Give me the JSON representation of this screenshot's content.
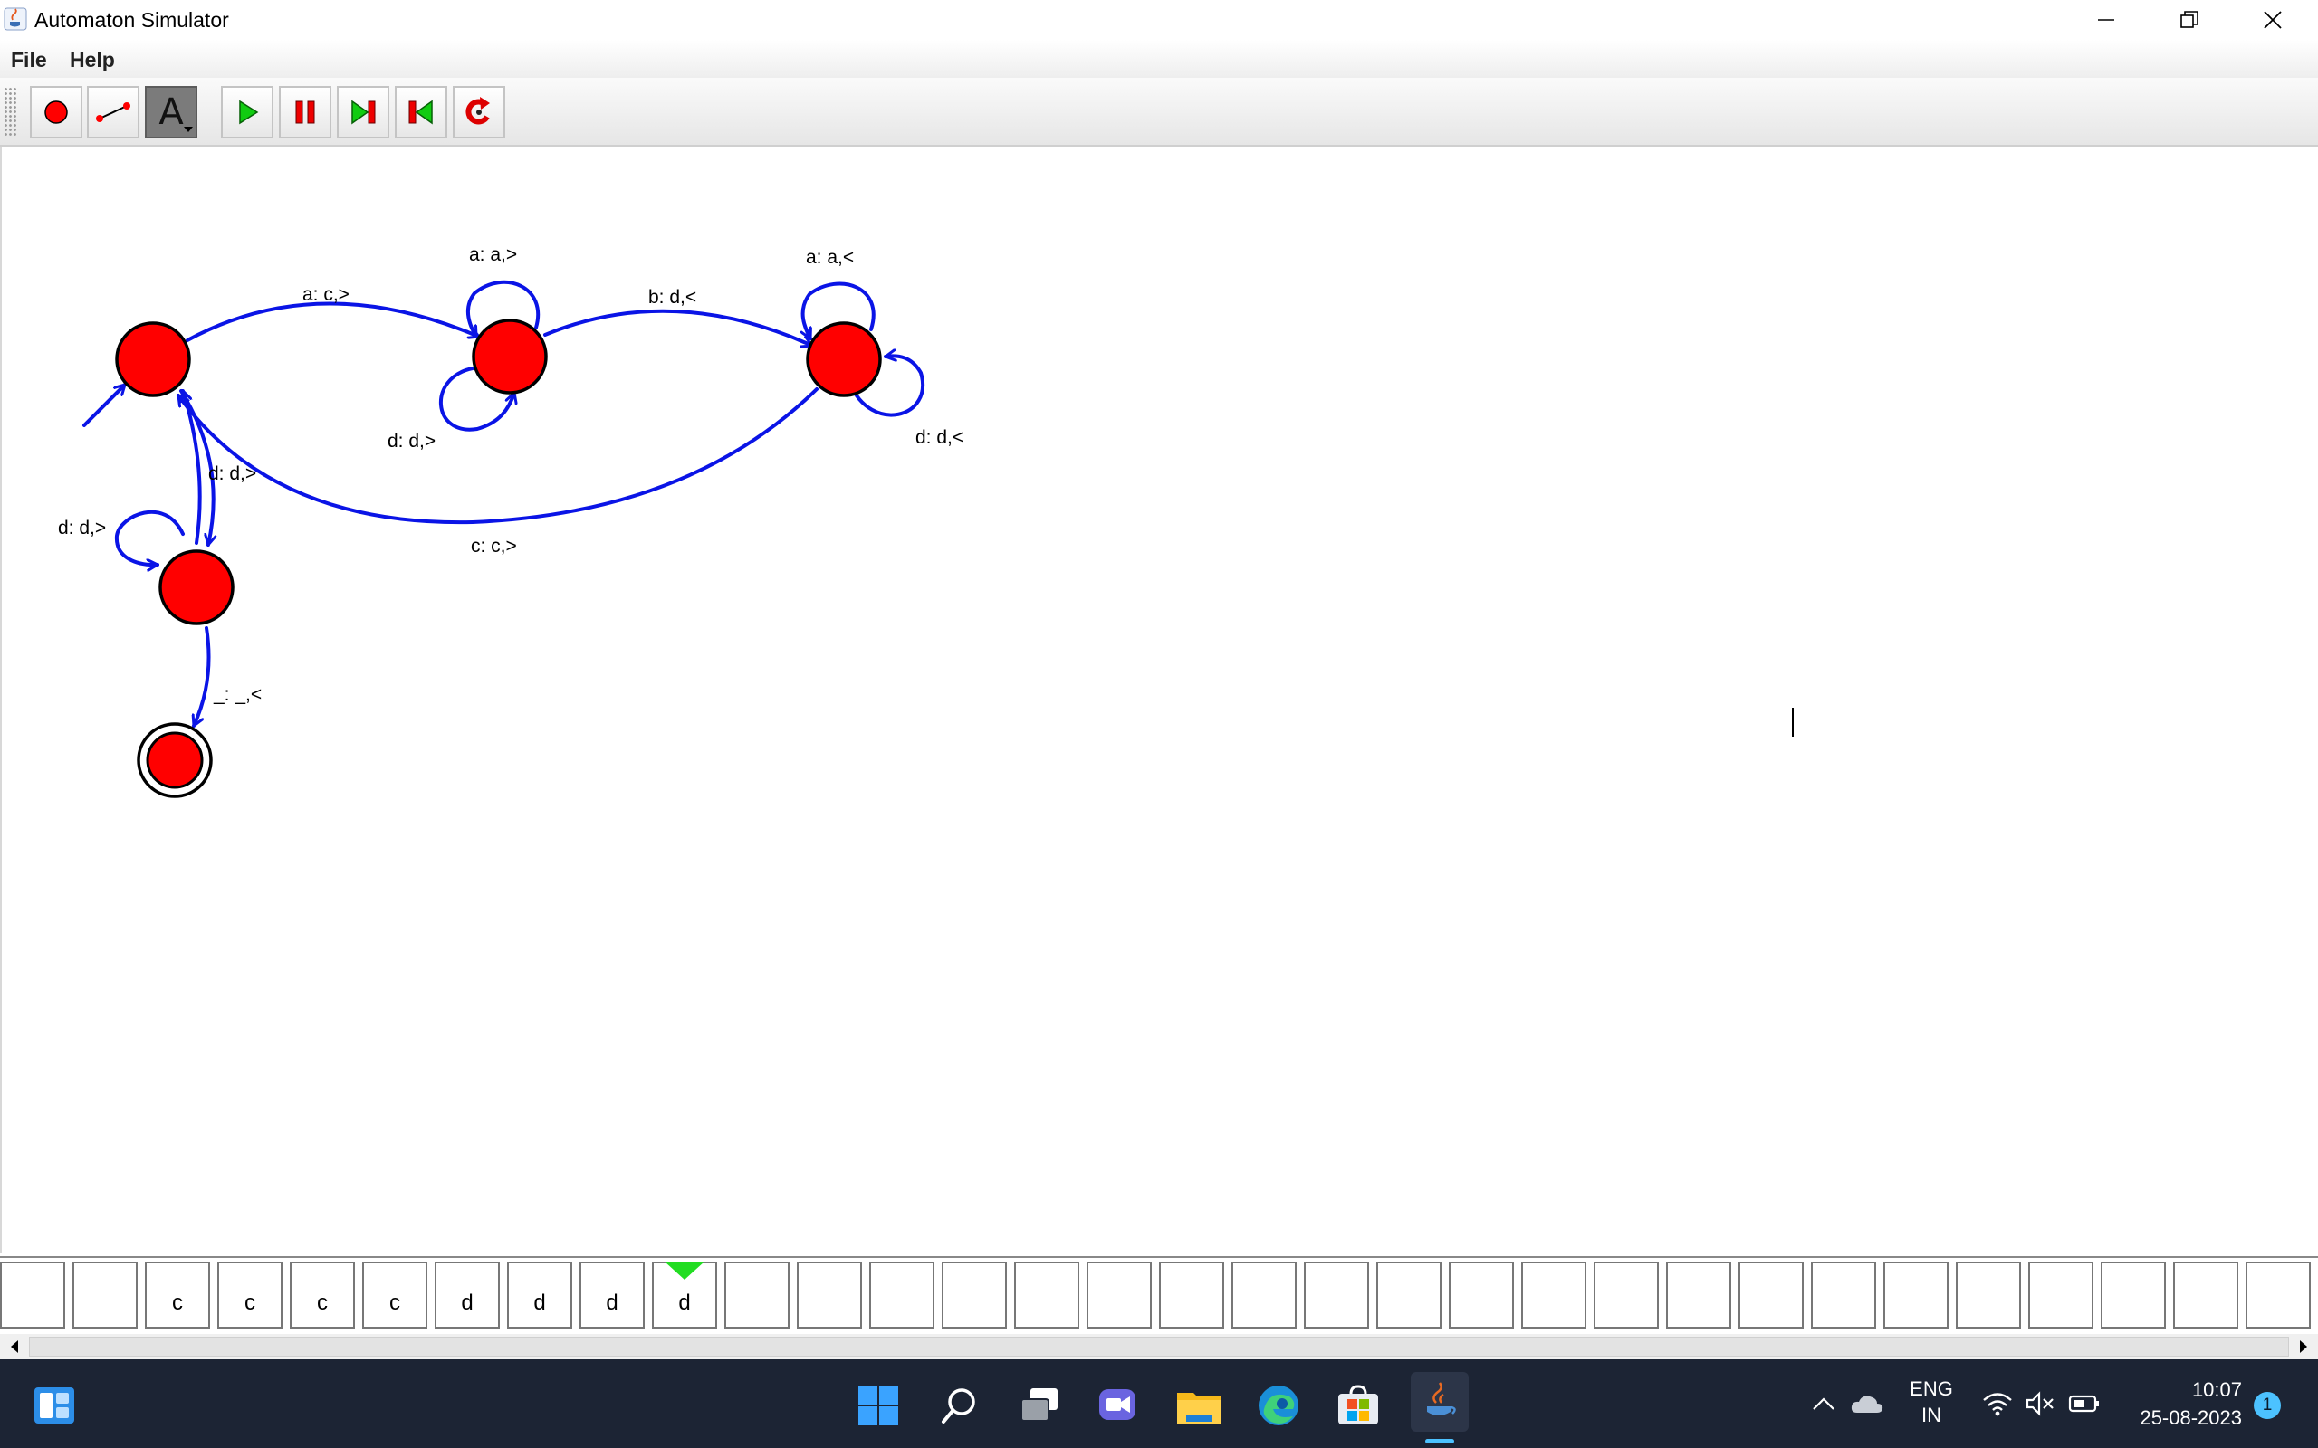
{
  "window": {
    "title": "Automaton Simulator"
  },
  "menu": {
    "file": "File",
    "help": "Help"
  },
  "toolbar": {
    "buttons": [
      {
        "name": "add-state-tool",
        "icon": "red-circle-icon"
      },
      {
        "name": "add-transition-tool",
        "icon": "transition-line-icon"
      },
      {
        "name": "text-tool",
        "icon": "letter-a-icon",
        "glyph": "A",
        "active": true
      },
      {
        "name": "run-button",
        "icon": "play-icon"
      },
      {
        "name": "pause-button",
        "icon": "pause-icon"
      },
      {
        "name": "step-forward-button",
        "icon": "step-forward-icon"
      },
      {
        "name": "step-back-button",
        "icon": "step-back-icon"
      },
      {
        "name": "reset-button",
        "icon": "reset-icon"
      }
    ]
  },
  "automaton": {
    "states": [
      {
        "id": "q0",
        "initial": true,
        "final": false
      },
      {
        "id": "q1",
        "initial": false,
        "final": false
      },
      {
        "id": "q2",
        "initial": false,
        "final": false
      },
      {
        "id": "q3",
        "initial": false,
        "final": false
      },
      {
        "id": "q4",
        "initial": false,
        "final": true
      }
    ],
    "transitions": [
      {
        "from": "q0",
        "to": "q1",
        "label": "a: c,>"
      },
      {
        "from": "q1",
        "to": "q1",
        "label": "a: a,>"
      },
      {
        "from": "q1",
        "to": "q1",
        "label": "d: d,>"
      },
      {
        "from": "q1",
        "to": "q2",
        "label": "b: d,<"
      },
      {
        "from": "q2",
        "to": "q2",
        "label": "a: a,<"
      },
      {
        "from": "q2",
        "to": "q2",
        "label": "d: d,<"
      },
      {
        "from": "q2",
        "to": "q0",
        "label": "c: c,>"
      },
      {
        "from": "q0",
        "to": "q3",
        "label": "d: d,>"
      },
      {
        "from": "q3",
        "to": "q0",
        "label": ""
      },
      {
        "from": "q3",
        "to": "q3",
        "label": "d: d,>"
      },
      {
        "from": "q3",
        "to": "q4",
        "label": "_: _,<"
      }
    ]
  },
  "tape": {
    "cells": [
      "",
      "",
      "c",
      "c",
      "c",
      "c",
      "d",
      "d",
      "d",
      "d",
      "",
      "",
      "",
      "",
      "",
      "",
      "",
      "",
      "",
      "",
      "",
      "",
      "",
      "",
      "",
      "",
      "",
      "",
      "",
      "",
      "",
      ""
    ],
    "head_index": 9,
    "head_color": "#22dd22"
  },
  "taskbar": {
    "icons": [
      "widgets-icon",
      "start-icon",
      "search-icon",
      "task-view-icon",
      "teams-chat-icon",
      "file-explorer-icon",
      "edge-icon",
      "store-icon",
      "java-icon"
    ],
    "language_line1": "ENG",
    "language_line2": "IN",
    "time": "10:07",
    "date": "25-08-2023",
    "notification_count": "1"
  },
  "colors": {
    "state_fill": "#ff0000",
    "edge": "#0a14e6",
    "taskbar_bg": "#1c2434"
  }
}
